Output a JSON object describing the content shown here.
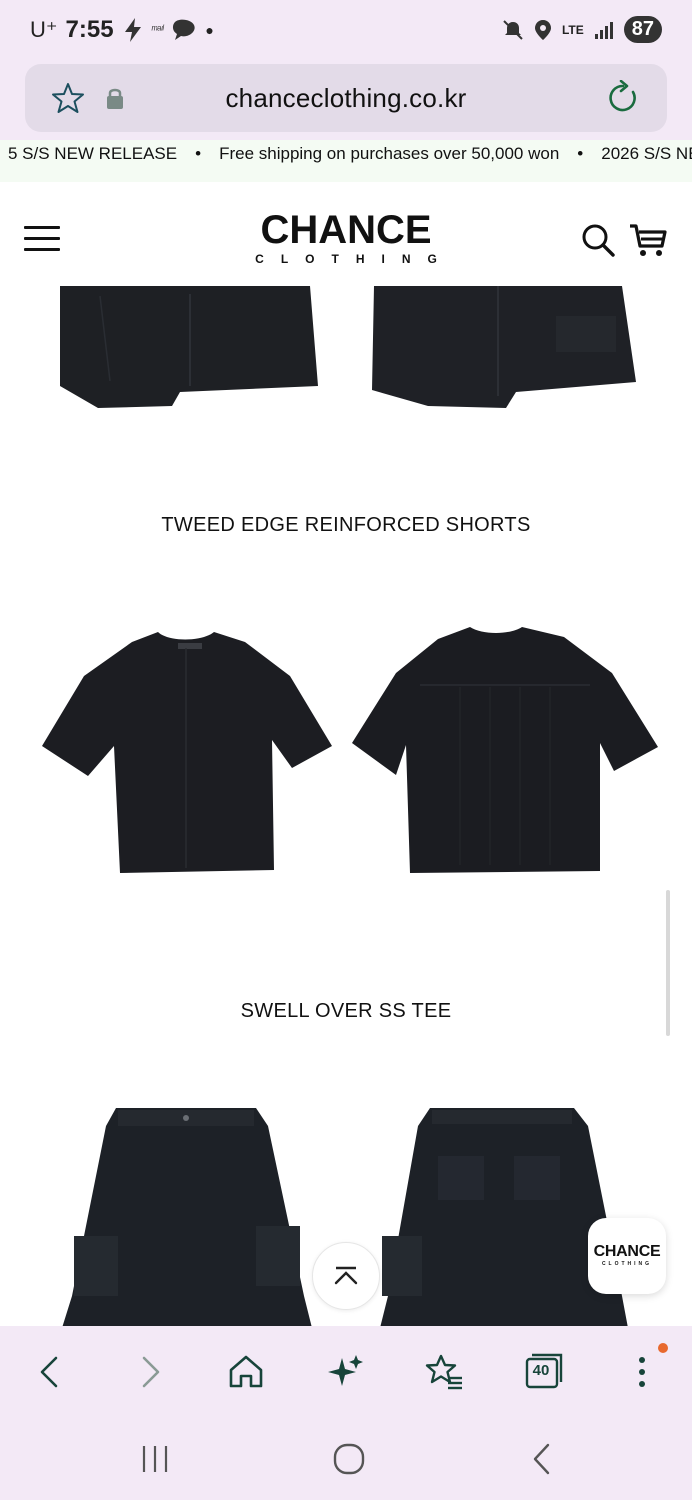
{
  "status_bar": {
    "carrier": "U⁺",
    "time": "7:55",
    "small_label": "ᵐᵃᶦˡ",
    "network": "LTE",
    "battery": "87"
  },
  "browser": {
    "url": "chanceclothing.co.kr",
    "tab_count": "40"
  },
  "ticker": {
    "items": [
      "5 S/S NEW RELEASE",
      "Free shipping on purchases over 50,000 won",
      "2026 S/S NE"
    ],
    "separator": "•"
  },
  "site": {
    "logo_main": "CHANCE",
    "logo_sub": "CLOTHING"
  },
  "products": [
    {
      "name": "TWEED EDGE REINFORCED SHORTS"
    },
    {
      "name": "SWELL OVER SS TEE"
    }
  ],
  "floating_badge": {
    "main": "CHANCE",
    "sub": "CLOTHING"
  },
  "icons": [
    "star-icon",
    "lock-icon",
    "reload-icon",
    "hamburger-icon",
    "search-icon",
    "cart-icon",
    "chevron-up-icon",
    "back-icon",
    "forward-icon",
    "home-icon",
    "sparkle-icon",
    "bookmarks-icon",
    "tabs-icon",
    "more-icon",
    "recents-icon",
    "home-circle-icon",
    "nav-back-icon"
  ],
  "colors": {
    "chrome_bg": "#f3e9f6",
    "url_bar_bg": "#e3dbe8",
    "ticker_bg": "#f4fbf3",
    "toolbar_icon": "#17443a",
    "notification_dot": "#e8692e"
  }
}
